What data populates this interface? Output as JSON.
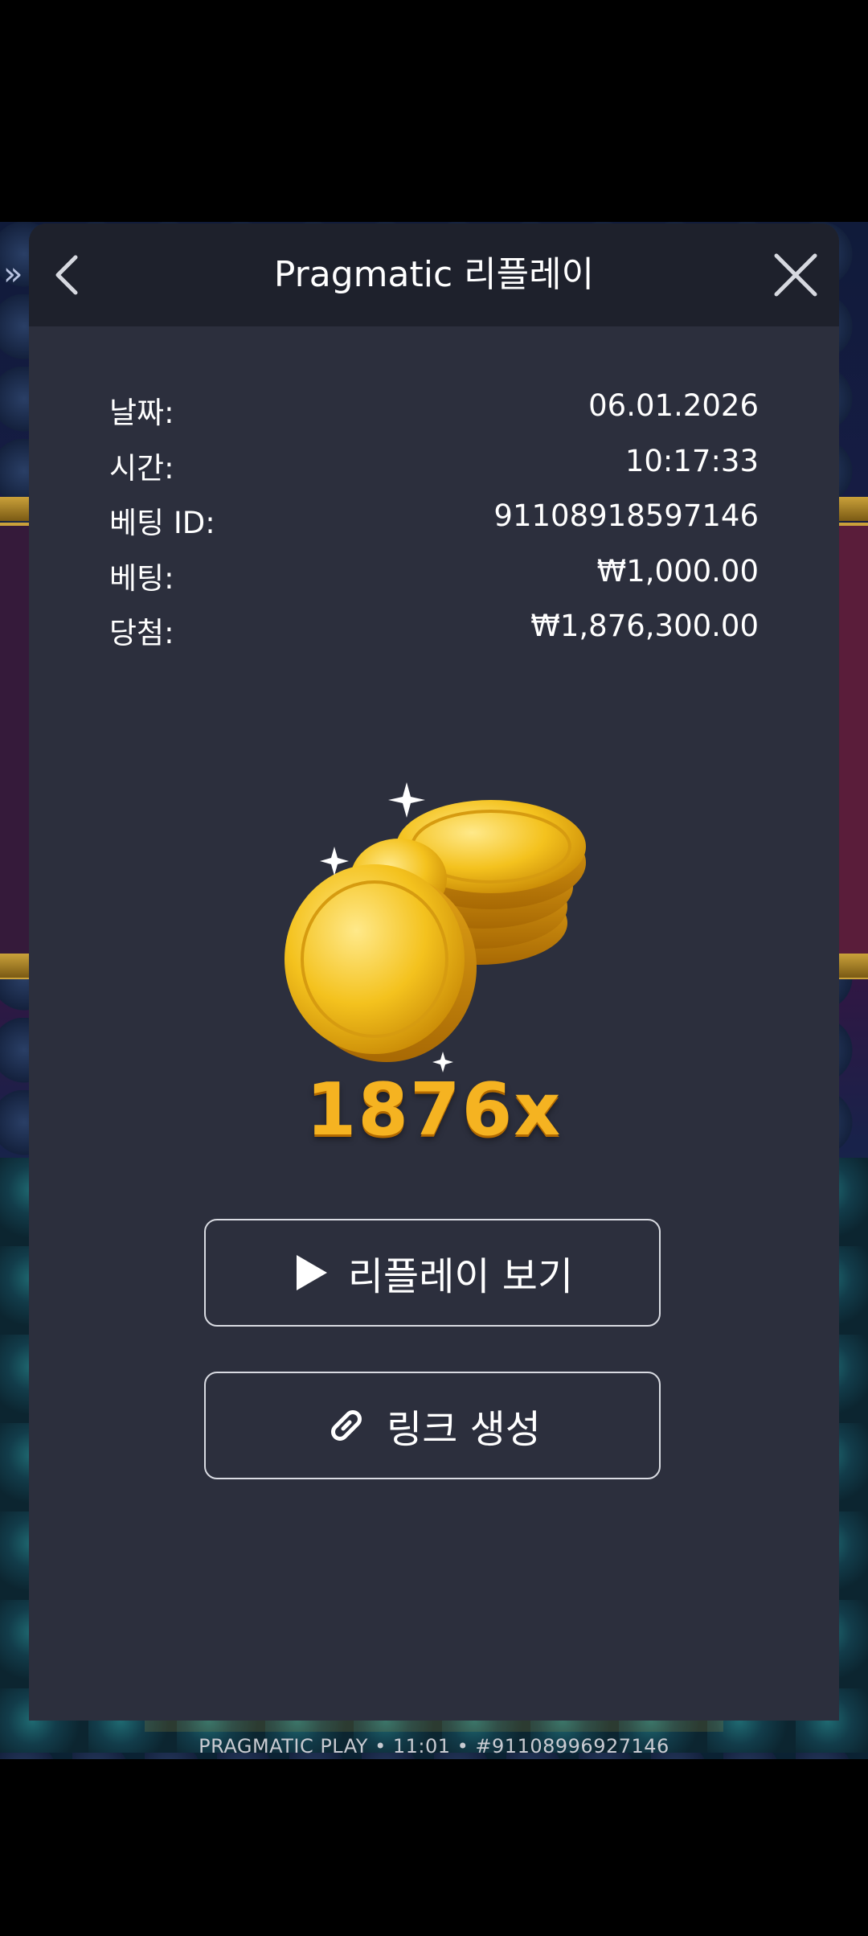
{
  "background": {
    "footer_text": "PRAGMATIC PLAY • 11:01 • #91108996927146",
    "arrow_glyph": "»"
  },
  "modal": {
    "title": "Pragmatic 리플레이",
    "info": [
      {
        "label": "날짜:",
        "value": "06.01.2026"
      },
      {
        "label": "시간:",
        "value": "10:17:33"
      },
      {
        "label": "베팅 ID:",
        "value": "91108918597146"
      },
      {
        "label": "베팅:",
        "value": "₩1,000.00"
      },
      {
        "label": "당첨:",
        "value": "₩1,876,300.00"
      }
    ],
    "multiplier": "1876x",
    "buttons": {
      "replay_label": "리플레이 보기",
      "link_label": "링크 생성"
    },
    "icons": {
      "back": "chevron-left-icon",
      "close": "close-icon",
      "play": "play-icon",
      "link": "link-icon",
      "coins": "gold-coins-icon"
    }
  },
  "colors": {
    "modal_bg": "#2c2f3d",
    "header_bg": "#1e212c",
    "multiplier": "#f5b321"
  }
}
